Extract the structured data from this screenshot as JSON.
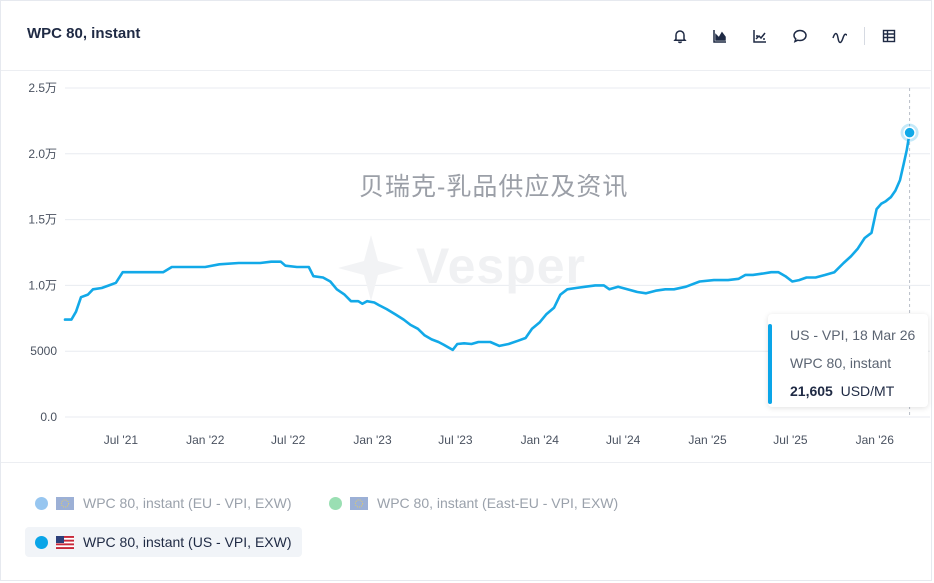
{
  "header": {
    "title": "WPC 80, instant",
    "tools": [
      "bell-icon",
      "area-chart-icon",
      "trend-chart-icon",
      "comment-icon",
      "wave-icon",
      "table-icon"
    ]
  },
  "watermark": {
    "text": "贝瑞克-乳品供应及资讯",
    "brand": "Vesper"
  },
  "tooltip": {
    "series": "US - VPI, 18 Mar 26",
    "product": "WPC 80, instant",
    "value": "21,605",
    "unit": "USD/MT"
  },
  "legend": [
    {
      "label": "WPC 80, instant (EU - VPI, EXW)",
      "color": "#8cc0ee",
      "flag": "eu",
      "active": false
    },
    {
      "label": "WPC 80, instant (East-EU - VPI, EXW)",
      "color": "#8fdcab",
      "flag": "eu",
      "active": false
    },
    {
      "label": "WPC 80, instant (US - VPI, EXW)",
      "color": "#0aa5e8",
      "flag": "us",
      "active": true
    }
  ],
  "colors": {
    "line": "#12a9e8",
    "grid": "#e8ebf0",
    "axis_text": "#4a5260",
    "title": "#1f2a44"
  },
  "chart_data": {
    "type": "line",
    "ylim": [
      0,
      25000
    ],
    "yticks": [
      {
        "value": 0,
        "label": "0.0"
      },
      {
        "value": 5000,
        "label": "5000"
      },
      {
        "value": 10000,
        "label": "1.0万"
      },
      {
        "value": 15000,
        "label": "1.5万"
      },
      {
        "value": 20000,
        "label": "2.0万"
      },
      {
        "value": 25000,
        "label": "2.5万"
      }
    ],
    "xlim": [
      "2021-03-01",
      "2026-04-01"
    ],
    "xticks": [
      {
        "date": "2021-07-01",
        "label": "Jul '21"
      },
      {
        "date": "2022-01-01",
        "label": "Jan '22"
      },
      {
        "date": "2022-07-01",
        "label": "Jul '22"
      },
      {
        "date": "2023-01-01",
        "label": "Jan '23"
      },
      {
        "date": "2023-07-01",
        "label": "Jul '23"
      },
      {
        "date": "2024-01-01",
        "label": "Jan '24"
      },
      {
        "date": "2024-07-01",
        "label": "Jul '24"
      },
      {
        "date": "2025-01-01",
        "label": "Jan '25"
      },
      {
        "date": "2025-07-01",
        "label": "Jul '25"
      },
      {
        "date": "2026-01-01",
        "label": "Jan '26"
      }
    ],
    "series": [
      {
        "name": "WPC 80, instant (US - VPI, EXW)",
        "color": "#12a9e8",
        "points": [
          [
            "2021-03-01",
            7400
          ],
          [
            "2021-03-15",
            7400
          ],
          [
            "2021-03-25",
            8000
          ],
          [
            "2021-04-05",
            9100
          ],
          [
            "2021-04-20",
            9300
          ],
          [
            "2021-05-01",
            9700
          ],
          [
            "2021-05-20",
            9800
          ],
          [
            "2021-06-05",
            10000
          ],
          [
            "2021-06-20",
            10200
          ],
          [
            "2021-07-05",
            11000
          ],
          [
            "2021-07-20",
            11000
          ],
          [
            "2021-09-01",
            11000
          ],
          [
            "2021-10-01",
            11000
          ],
          [
            "2021-10-20",
            11400
          ],
          [
            "2021-12-01",
            11400
          ],
          [
            "2022-01-01",
            11400
          ],
          [
            "2022-02-01",
            11600
          ],
          [
            "2022-03-15",
            11700
          ],
          [
            "2022-05-01",
            11700
          ],
          [
            "2022-05-25",
            11800
          ],
          [
            "2022-06-15",
            11800
          ],
          [
            "2022-06-25",
            11500
          ],
          [
            "2022-07-20",
            11400
          ],
          [
            "2022-08-15",
            11400
          ],
          [
            "2022-08-25",
            10700
          ],
          [
            "2022-09-15",
            10600
          ],
          [
            "2022-10-01",
            10300
          ],
          [
            "2022-10-15",
            9700
          ],
          [
            "2022-11-01",
            9300
          ],
          [
            "2022-11-15",
            8800
          ],
          [
            "2022-12-01",
            8800
          ],
          [
            "2022-12-10",
            8600
          ],
          [
            "2022-12-20",
            8800
          ],
          [
            "2023-01-05",
            8700
          ],
          [
            "2023-01-15",
            8500
          ],
          [
            "2023-02-01",
            8200
          ],
          [
            "2023-02-20",
            7800
          ],
          [
            "2023-03-10",
            7400
          ],
          [
            "2023-03-25",
            7000
          ],
          [
            "2023-04-10",
            6700
          ],
          [
            "2023-04-25",
            6200
          ],
          [
            "2023-05-10",
            5900
          ],
          [
            "2023-05-25",
            5700
          ],
          [
            "2023-06-05",
            5500
          ],
          [
            "2023-06-15",
            5300
          ],
          [
            "2023-06-25",
            5100
          ],
          [
            "2023-07-05",
            5550
          ],
          [
            "2023-07-20",
            5600
          ],
          [
            "2023-08-05",
            5550
          ],
          [
            "2023-08-20",
            5700
          ],
          [
            "2023-09-15",
            5700
          ],
          [
            "2023-10-05",
            5400
          ],
          [
            "2023-10-25",
            5550
          ],
          [
            "2023-11-15",
            5800
          ],
          [
            "2023-12-01",
            6000
          ],
          [
            "2023-12-15",
            6700
          ],
          [
            "2024-01-01",
            7200
          ],
          [
            "2024-01-15",
            7800
          ],
          [
            "2024-02-01",
            8300
          ],
          [
            "2024-02-15",
            9300
          ],
          [
            "2024-03-01",
            9700
          ],
          [
            "2024-03-20",
            9800
          ],
          [
            "2024-04-10",
            9900
          ],
          [
            "2024-05-01",
            10000
          ],
          [
            "2024-05-20",
            10000
          ],
          [
            "2024-06-01",
            9700
          ],
          [
            "2024-06-20",
            9900
          ],
          [
            "2024-07-10",
            9700
          ],
          [
            "2024-08-01",
            9500
          ],
          [
            "2024-08-20",
            9400
          ],
          [
            "2024-09-10",
            9600
          ],
          [
            "2024-10-01",
            9700
          ],
          [
            "2024-10-20",
            9700
          ],
          [
            "2024-11-15",
            9900
          ],
          [
            "2024-12-15",
            10300
          ],
          [
            "2025-01-15",
            10400
          ],
          [
            "2025-02-15",
            10400
          ],
          [
            "2025-03-10",
            10500
          ],
          [
            "2025-03-25",
            10800
          ],
          [
            "2025-04-10",
            10800
          ],
          [
            "2025-05-01",
            10900
          ],
          [
            "2025-05-20",
            11000
          ],
          [
            "2025-06-05",
            11000
          ],
          [
            "2025-06-20",
            10700
          ],
          [
            "2025-07-05",
            10300
          ],
          [
            "2025-07-20",
            10400
          ],
          [
            "2025-08-05",
            10600
          ],
          [
            "2025-08-25",
            10600
          ],
          [
            "2025-09-15",
            10800
          ],
          [
            "2025-10-05",
            11000
          ],
          [
            "2025-10-25",
            11700
          ],
          [
            "2025-11-10",
            12200
          ],
          [
            "2025-11-25",
            12800
          ],
          [
            "2025-12-10",
            13600
          ],
          [
            "2025-12-25",
            14000
          ],
          [
            "2026-01-05",
            15800
          ],
          [
            "2026-01-15",
            16200
          ],
          [
            "2026-01-25",
            16400
          ],
          [
            "2026-02-05",
            16700
          ],
          [
            "2026-02-15",
            17200
          ],
          [
            "2026-02-25",
            18000
          ],
          [
            "2026-03-05",
            19200
          ],
          [
            "2026-03-12",
            20300
          ],
          [
            "2026-03-18",
            21605
          ]
        ]
      }
    ],
    "highlight": {
      "date": "2026-03-18",
      "value": 21605
    },
    "grid": true,
    "legend_position": "bottom-left"
  }
}
